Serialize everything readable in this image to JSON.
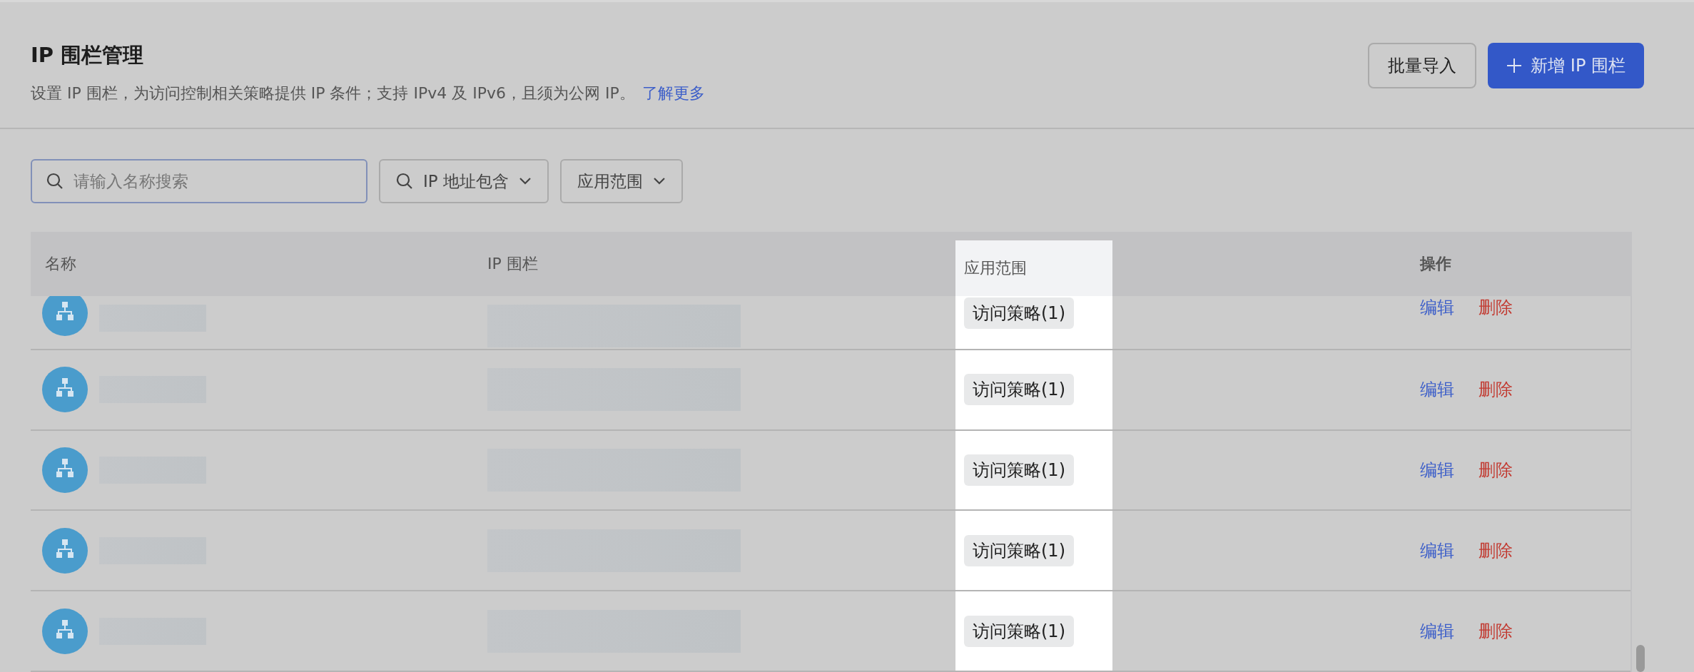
{
  "header": {
    "title": "IP 围栏管理",
    "description": "设置 IP 围栏，为访问控制相关策略提供 IP 条件；支持 IPv4 及 IPv6，且须为公网 IP。",
    "learn_more_link": "了解更多"
  },
  "actions": [
    {
      "kind": "secondary",
      "label": "批量导入"
    },
    {
      "kind": "primary",
      "label": "新增 IP 围栏"
    }
  ],
  "filters": {
    "search": {
      "placeholder": "请输入名称搜索"
    },
    "dropdowns": [
      {
        "label": "IP 地址包含"
      },
      {
        "label": "应用范围"
      }
    ]
  },
  "table": {
    "columns": [
      {
        "label": "名称",
        "highlighted": false
      },
      {
        "label": "IP 围栏",
        "highlighted": false
      },
      {
        "label": "应用范围",
        "highlighted": true
      },
      {
        "label": "操作",
        "highlighted": false
      }
    ],
    "rows": [
      {
        "scope": "访问策略(1)",
        "edit": "编辑",
        "delete": "删除"
      },
      {
        "scope": "访问策略(1)",
        "edit": "编辑",
        "delete": "删除"
      },
      {
        "scope": "访问策略(1)",
        "edit": "编辑",
        "delete": "删除"
      },
      {
        "scope": "访问策略(1)",
        "edit": "编辑",
        "delete": "删除"
      },
      {
        "scope": "访问策略(1)",
        "edit": "编辑",
        "delete": "删除"
      }
    ]
  }
}
